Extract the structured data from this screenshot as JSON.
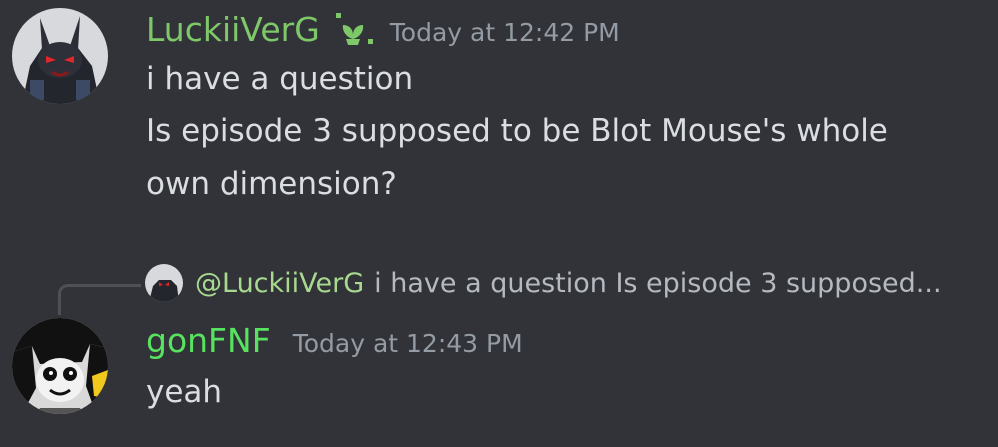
{
  "messages": [
    {
      "username": "LuckiiVerG",
      "username_color": "#7fc86a",
      "timestamp": "Today at 12:42 PM",
      "lines": [
        "i have a question",
        "Is episode 3 supposed to be Blot Mouse's whole",
        "own dimension?"
      ]
    },
    {
      "reply": {
        "mention": "@LuckiiVerG",
        "preview": "i have a question Is episode 3 supposed..."
      },
      "username": "gonFNF",
      "username_color": "#57e35f",
      "timestamp": "Today at 12:43 PM",
      "lines": [
        "yeah"
      ]
    }
  ]
}
